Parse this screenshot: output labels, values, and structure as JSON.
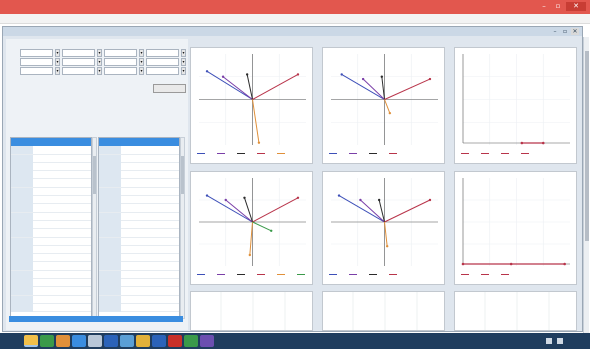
{
  "window": {
    "title": ""
  },
  "menu": {
    "items": [
      "",
      "",
      "",
      ""
    ]
  },
  "child_window": {
    "title": ""
  },
  "controls": {
    "headers": [
      "",
      "",
      "",
      ""
    ],
    "rows": [
      {
        "label": ""
      },
      {
        "label": ""
      },
      {
        "label": ""
      }
    ],
    "options": [
      "",
      "",
      ""
    ],
    "calculate_label": ""
  },
  "section_labels": {
    "measurement_1": "",
    "measurement_2": ""
  },
  "tables": {
    "left": {
      "header": [
        "",
        "",
        ""
      ],
      "rows": [
        [
          "",
          "",
          ""
        ],
        [
          "",
          "",
          ""
        ],
        [
          "",
          "",
          ""
        ],
        [
          "",
          "",
          ""
        ],
        [
          "",
          "",
          ""
        ],
        [
          "",
          "",
          ""
        ],
        [
          "",
          "",
          ""
        ],
        [
          "",
          "",
          ""
        ],
        [
          "",
          "",
          ""
        ],
        [
          "",
          "",
          ""
        ],
        [
          "",
          "",
          ""
        ],
        [
          "",
          "",
          ""
        ],
        [
          "",
          "",
          ""
        ],
        [
          "",
          "",
          ""
        ],
        [
          "",
          "",
          ""
        ],
        [
          "",
          "",
          ""
        ],
        [
          "",
          "",
          ""
        ],
        [
          "",
          "",
          ""
        ],
        [
          "",
          "",
          ""
        ],
        [
          "",
          "",
          ""
        ]
      ]
    },
    "right": {
      "header": [
        "",
        "",
        ""
      ],
      "rows": [
        [
          "",
          "",
          ""
        ],
        [
          "",
          "",
          ""
        ],
        [
          "",
          "",
          ""
        ],
        [
          "",
          "",
          ""
        ],
        [
          "",
          "",
          ""
        ],
        [
          "",
          "",
          ""
        ],
        [
          "",
          "",
          ""
        ],
        [
          "",
          "",
          ""
        ],
        [
          "",
          "",
          ""
        ],
        [
          "",
          "",
          ""
        ],
        [
          "",
          "",
          ""
        ],
        [
          "",
          "",
          ""
        ],
        [
          "",
          "",
          ""
        ],
        [
          "",
          "",
          ""
        ],
        [
          "",
          "",
          ""
        ],
        [
          "",
          "",
          ""
        ],
        [
          "",
          "",
          ""
        ],
        [
          "",
          "",
          ""
        ],
        [
          "",
          "",
          ""
        ],
        [
          "",
          "",
          ""
        ]
      ]
    }
  },
  "colors": {
    "titlebar": "#e2574e",
    "selection": "#3a8de0",
    "vector_blue": "#3d4fb8",
    "vector_purple": "#7a3fa8",
    "vector_dark": "#2b2b2b",
    "vector_red": "#b8344a",
    "vector_orange": "#e0903a",
    "vector_green": "#3a9a4a"
  },
  "plots": [
    {
      "id": "phasor-1",
      "type": "vector",
      "xlim": [
        -1,
        1
      ],
      "ylim": [
        -1,
        1
      ],
      "vectors": [
        {
          "series": "a",
          "color": "#3d4fb8",
          "x": -0.85,
          "y": 0.62
        },
        {
          "series": "b",
          "color": "#7a3fa8",
          "x": -0.55,
          "y": 0.5
        },
        {
          "series": "c",
          "color": "#2b2b2b",
          "x": -0.1,
          "y": 0.55
        },
        {
          "series": "d",
          "color": "#b8344a",
          "x": 0.85,
          "y": 0.55
        },
        {
          "series": "e",
          "color": "#e0903a",
          "x": 0.12,
          "y": -0.95
        }
      ],
      "x_ticks": [
        "",
        "",
        "",
        "",
        ""
      ],
      "y_ticks": [
        "",
        "",
        "",
        ""
      ],
      "legend": [
        "",
        "",
        "",
        "",
        ""
      ]
    },
    {
      "id": "phasor-2",
      "type": "vector",
      "xlim": [
        -1,
        1
      ],
      "ylim": [
        -1,
        1
      ],
      "vectors": [
        {
          "series": "a",
          "color": "#3d4fb8",
          "x": -0.8,
          "y": 0.55
        },
        {
          "series": "b",
          "color": "#7a3fa8",
          "x": -0.4,
          "y": 0.45
        },
        {
          "series": "c",
          "color": "#2b2b2b",
          "x": -0.05,
          "y": 0.5
        },
        {
          "series": "d",
          "color": "#b8344a",
          "x": 0.85,
          "y": 0.45
        },
        {
          "series": "e",
          "color": "#e0903a",
          "x": 0.1,
          "y": -0.3
        }
      ],
      "x_ticks": [
        "",
        "",
        "",
        "",
        ""
      ],
      "y_ticks": [
        "",
        "",
        "",
        ""
      ],
      "legend": [
        "",
        "",
        "",
        ""
      ]
    },
    {
      "id": "trace-1",
      "type": "trace",
      "xlim": [
        0,
        1
      ],
      "ylim": [
        0,
        1
      ],
      "points": [
        {
          "x": 0.55,
          "y": 0.0,
          "color": "#b8344a"
        },
        {
          "x": 0.75,
          "y": 0.0,
          "color": "#b8344a"
        }
      ],
      "x_ticks": [
        "",
        "",
        "",
        "",
        ""
      ],
      "legend": [
        "",
        "",
        "",
        ""
      ]
    },
    {
      "id": "phasor-3",
      "type": "vector",
      "xlim": [
        -1,
        1
      ],
      "ylim": [
        -1,
        1
      ],
      "vectors": [
        {
          "series": "a",
          "color": "#3d4fb8",
          "x": -0.85,
          "y": 0.6
        },
        {
          "series": "b",
          "color": "#7a3fa8",
          "x": -0.5,
          "y": 0.5
        },
        {
          "series": "c",
          "color": "#2b2b2b",
          "x": -0.15,
          "y": 0.55
        },
        {
          "series": "d",
          "color": "#b8344a",
          "x": 0.85,
          "y": 0.55
        },
        {
          "series": "e",
          "color": "#e0903a",
          "x": -0.05,
          "y": -0.75
        },
        {
          "series": "f",
          "color": "#3a9a4a",
          "x": 0.35,
          "y": -0.2
        }
      ],
      "x_ticks": [
        "",
        "",
        "",
        "",
        ""
      ],
      "y_ticks": [
        "",
        "",
        "",
        ""
      ],
      "legend": [
        "",
        "",
        "",
        "",
        "",
        ""
      ]
    },
    {
      "id": "phasor-4",
      "type": "vector",
      "xlim": [
        -1,
        1
      ],
      "ylim": [
        -1,
        1
      ],
      "vectors": [
        {
          "series": "a",
          "color": "#3d4fb8",
          "x": -0.85,
          "y": 0.6
        },
        {
          "series": "b",
          "color": "#7a3fa8",
          "x": -0.45,
          "y": 0.5
        },
        {
          "series": "c",
          "color": "#2b2b2b",
          "x": -0.1,
          "y": 0.5
        },
        {
          "series": "d",
          "color": "#b8344a",
          "x": 0.85,
          "y": 0.5
        },
        {
          "series": "e",
          "color": "#e0903a",
          "x": 0.05,
          "y": -0.55
        }
      ],
      "x_ticks": [
        "",
        "",
        "",
        "",
        ""
      ],
      "y_ticks": [
        "",
        "",
        "",
        ""
      ],
      "legend": [
        "",
        "",
        "",
        ""
      ]
    },
    {
      "id": "trace-2",
      "type": "trace",
      "xlim": [
        0,
        1
      ],
      "ylim": [
        0,
        1
      ],
      "points": [
        {
          "x": 0.0,
          "y": 0.0,
          "color": "#b8344a"
        },
        {
          "x": 0.45,
          "y": 0.0,
          "color": "#b8344a"
        },
        {
          "x": 0.95,
          "y": 0.0,
          "color": "#b8344a"
        }
      ],
      "x_ticks": [
        "",
        "",
        "",
        ""
      ],
      "legend": [
        "",
        "",
        ""
      ]
    },
    {
      "id": "empty-1",
      "type": "empty"
    },
    {
      "id": "empty-2",
      "type": "empty"
    },
    {
      "id": "empty-3",
      "type": "empty"
    }
  ],
  "taskbar": {
    "apps": [
      {
        "icon": "explorer-icon",
        "color": "#f1c04a"
      },
      {
        "icon": "browser-icon",
        "color": "#3a9a4a"
      },
      {
        "icon": "media-icon",
        "color": "#e0903a"
      },
      {
        "icon": "app-icon",
        "color": "#3a8de0"
      },
      {
        "icon": "folder-icon",
        "color": "#b8c7d8"
      },
      {
        "icon": "word-icon",
        "color": "#2b63b9"
      },
      {
        "icon": "app-icon",
        "color": "#5a9fd6"
      },
      {
        "icon": "app-icon",
        "color": "#e2b13a"
      },
      {
        "icon": "app-icon",
        "color": "#2b63b9"
      },
      {
        "icon": "pdf-icon",
        "color": "#c8302a"
      },
      {
        "icon": "app-icon",
        "color": "#3a9a4a"
      },
      {
        "icon": "app-icon",
        "color": "#6b4fb0"
      }
    ],
    "clock": ""
  }
}
